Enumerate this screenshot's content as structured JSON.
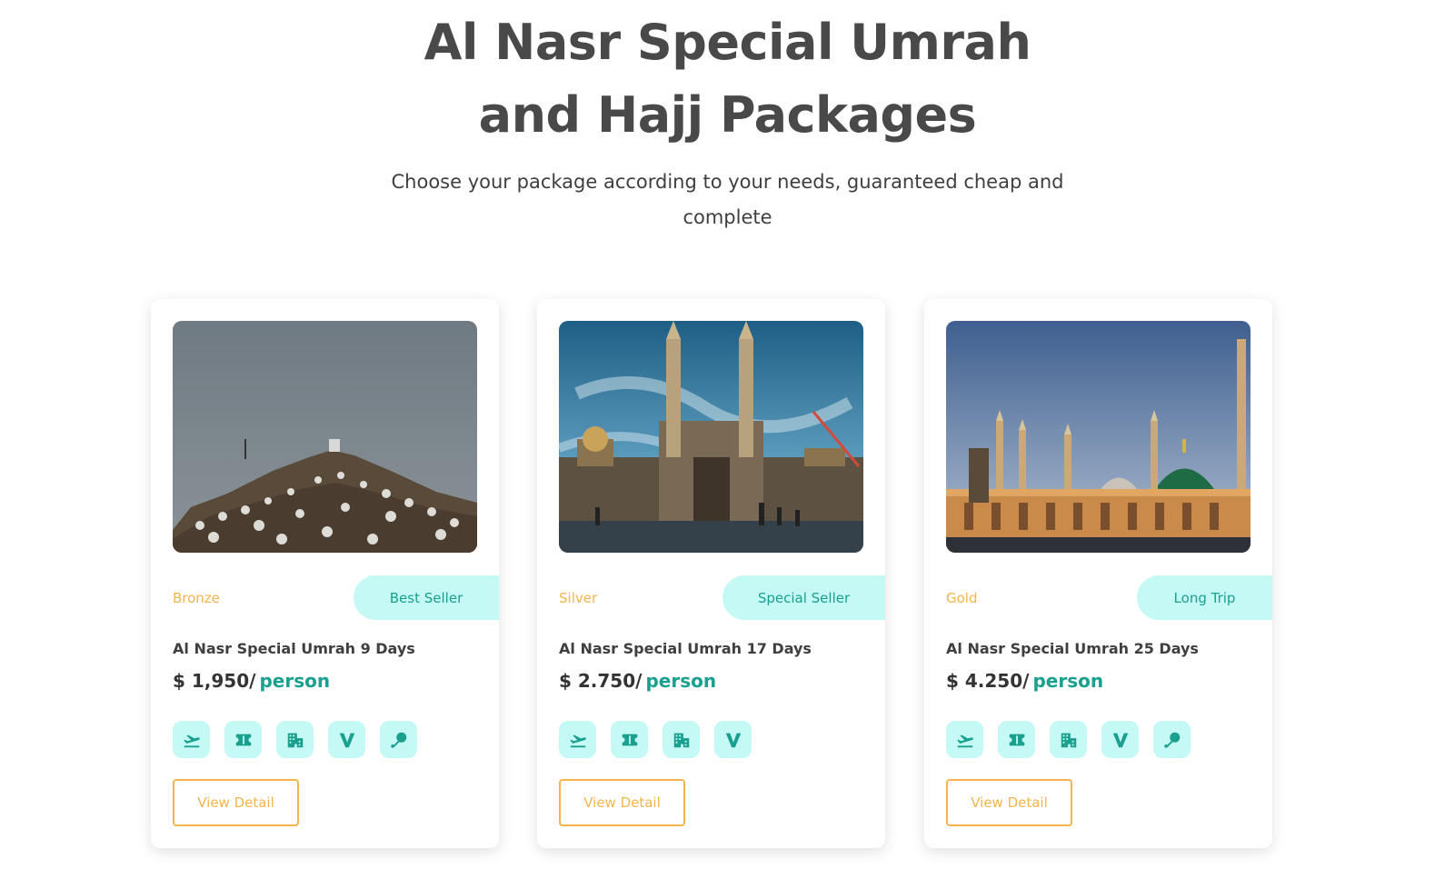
{
  "hero": {
    "title": "Al Nasr Special Umrah and Hajj Packages",
    "subtitle": "Choose your package according to your needs, guaranteed cheap and complete"
  },
  "colors": {
    "accent": "#19a08f",
    "accent_light": "#c5f9f5",
    "gold": "#f5b54b",
    "heading": "#494949"
  },
  "packages": [
    {
      "tier": "Bronze",
      "tag": "Best Seller",
      "title": "Al Nasr Special Umrah 9 Days",
      "price": "$ 1,950/",
      "price_unit": "person",
      "image": "arafat-mount-photo",
      "features": [
        "flight-icon",
        "ticket-icon",
        "hotel-icon",
        "visa-icon",
        "food-icon"
      ],
      "button": "View Detail"
    },
    {
      "tier": "Silver",
      "tag": "Special Seller",
      "title": "Al Nasr Special Umrah 17 Days",
      "price": "$ 2.750/",
      "price_unit": "person",
      "image": "masjid-al-haram-photo",
      "features": [
        "flight-icon",
        "ticket-icon",
        "hotel-icon",
        "visa-icon"
      ],
      "button": "View Detail"
    },
    {
      "tier": "Gold",
      "tag": "Long Trip",
      "title": "Al Nasr Special Umrah 25 Days",
      "price": "$ 4.250/",
      "price_unit": "person",
      "image": "masjid-nabawi-photo",
      "features": [
        "flight-icon",
        "ticket-icon",
        "hotel-icon",
        "visa-icon",
        "food-icon"
      ],
      "button": "View Detail"
    }
  ]
}
